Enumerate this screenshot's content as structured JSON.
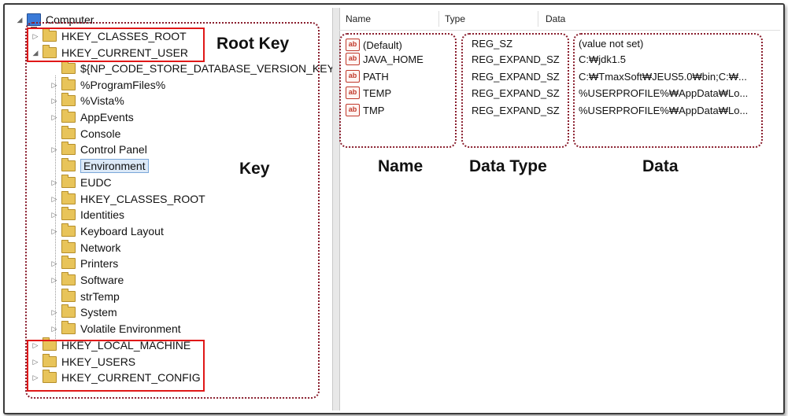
{
  "tree": {
    "root_label": "Computer",
    "nodes": [
      {
        "label": "HKEY_CLASSES_ROOT",
        "expander": "▷"
      },
      {
        "label": "HKEY_CURRENT_USER",
        "expander": "◢"
      },
      {
        "label": "${NP_CODE_STORE_DATABASE_VERSION_KEY}",
        "expander": ""
      },
      {
        "label": "%ProgramFiles%",
        "expander": "▷"
      },
      {
        "label": "%Vista%",
        "expander": "▷"
      },
      {
        "label": "AppEvents",
        "expander": "▷"
      },
      {
        "label": "Console",
        "expander": ""
      },
      {
        "label": "Control Panel",
        "expander": "▷"
      },
      {
        "label": "Environment",
        "expander": ""
      },
      {
        "label": "EUDC",
        "expander": "▷"
      },
      {
        "label": "HKEY_CLASSES_ROOT",
        "expander": "▷"
      },
      {
        "label": "Identities",
        "expander": "▷"
      },
      {
        "label": "Keyboard Layout",
        "expander": "▷"
      },
      {
        "label": "Network",
        "expander": ""
      },
      {
        "label": "Printers",
        "expander": "▷"
      },
      {
        "label": "Software",
        "expander": "▷"
      },
      {
        "label": "strTemp",
        "expander": ""
      },
      {
        "label": "System",
        "expander": "▷"
      },
      {
        "label": "Volatile Environment",
        "expander": "▷"
      },
      {
        "label": "HKEY_LOCAL_MACHINE",
        "expander": "▷"
      },
      {
        "label": "HKEY_USERS",
        "expander": "▷"
      },
      {
        "label": "HKEY_CURRENT_CONFIG",
        "expander": "▷"
      }
    ]
  },
  "columns": {
    "name": "Name",
    "type": "Type",
    "data": "Data"
  },
  "values": [
    {
      "name": "(Default)",
      "type": "REG_SZ",
      "data": "(value not set)"
    },
    {
      "name": "JAVA_HOME",
      "type": "REG_EXPAND_SZ",
      "data": "C:₩jdk1.5"
    },
    {
      "name": "PATH",
      "type": "REG_EXPAND_SZ",
      "data": "C:₩TmaxSoft₩JEUS5.0₩bin;C:₩..."
    },
    {
      "name": "TEMP",
      "type": "REG_EXPAND_SZ",
      "data": "%USERPROFILE%₩AppData₩Lo..."
    },
    {
      "name": "TMP",
      "type": "REG_EXPAND_SZ",
      "data": "%USERPROFILE%₩AppData₩Lo..."
    }
  ],
  "value_icon_text": "ab",
  "annotations": {
    "root_key": "Root Key",
    "key": "Key",
    "name": "Name",
    "data_type": "Data Type",
    "data": "Data"
  },
  "colors": {
    "annotation_red": "#e01818",
    "dotted_border": "#8a1f2e",
    "folder": "#e8c45a",
    "selected_bg": "#dce9f7"
  }
}
